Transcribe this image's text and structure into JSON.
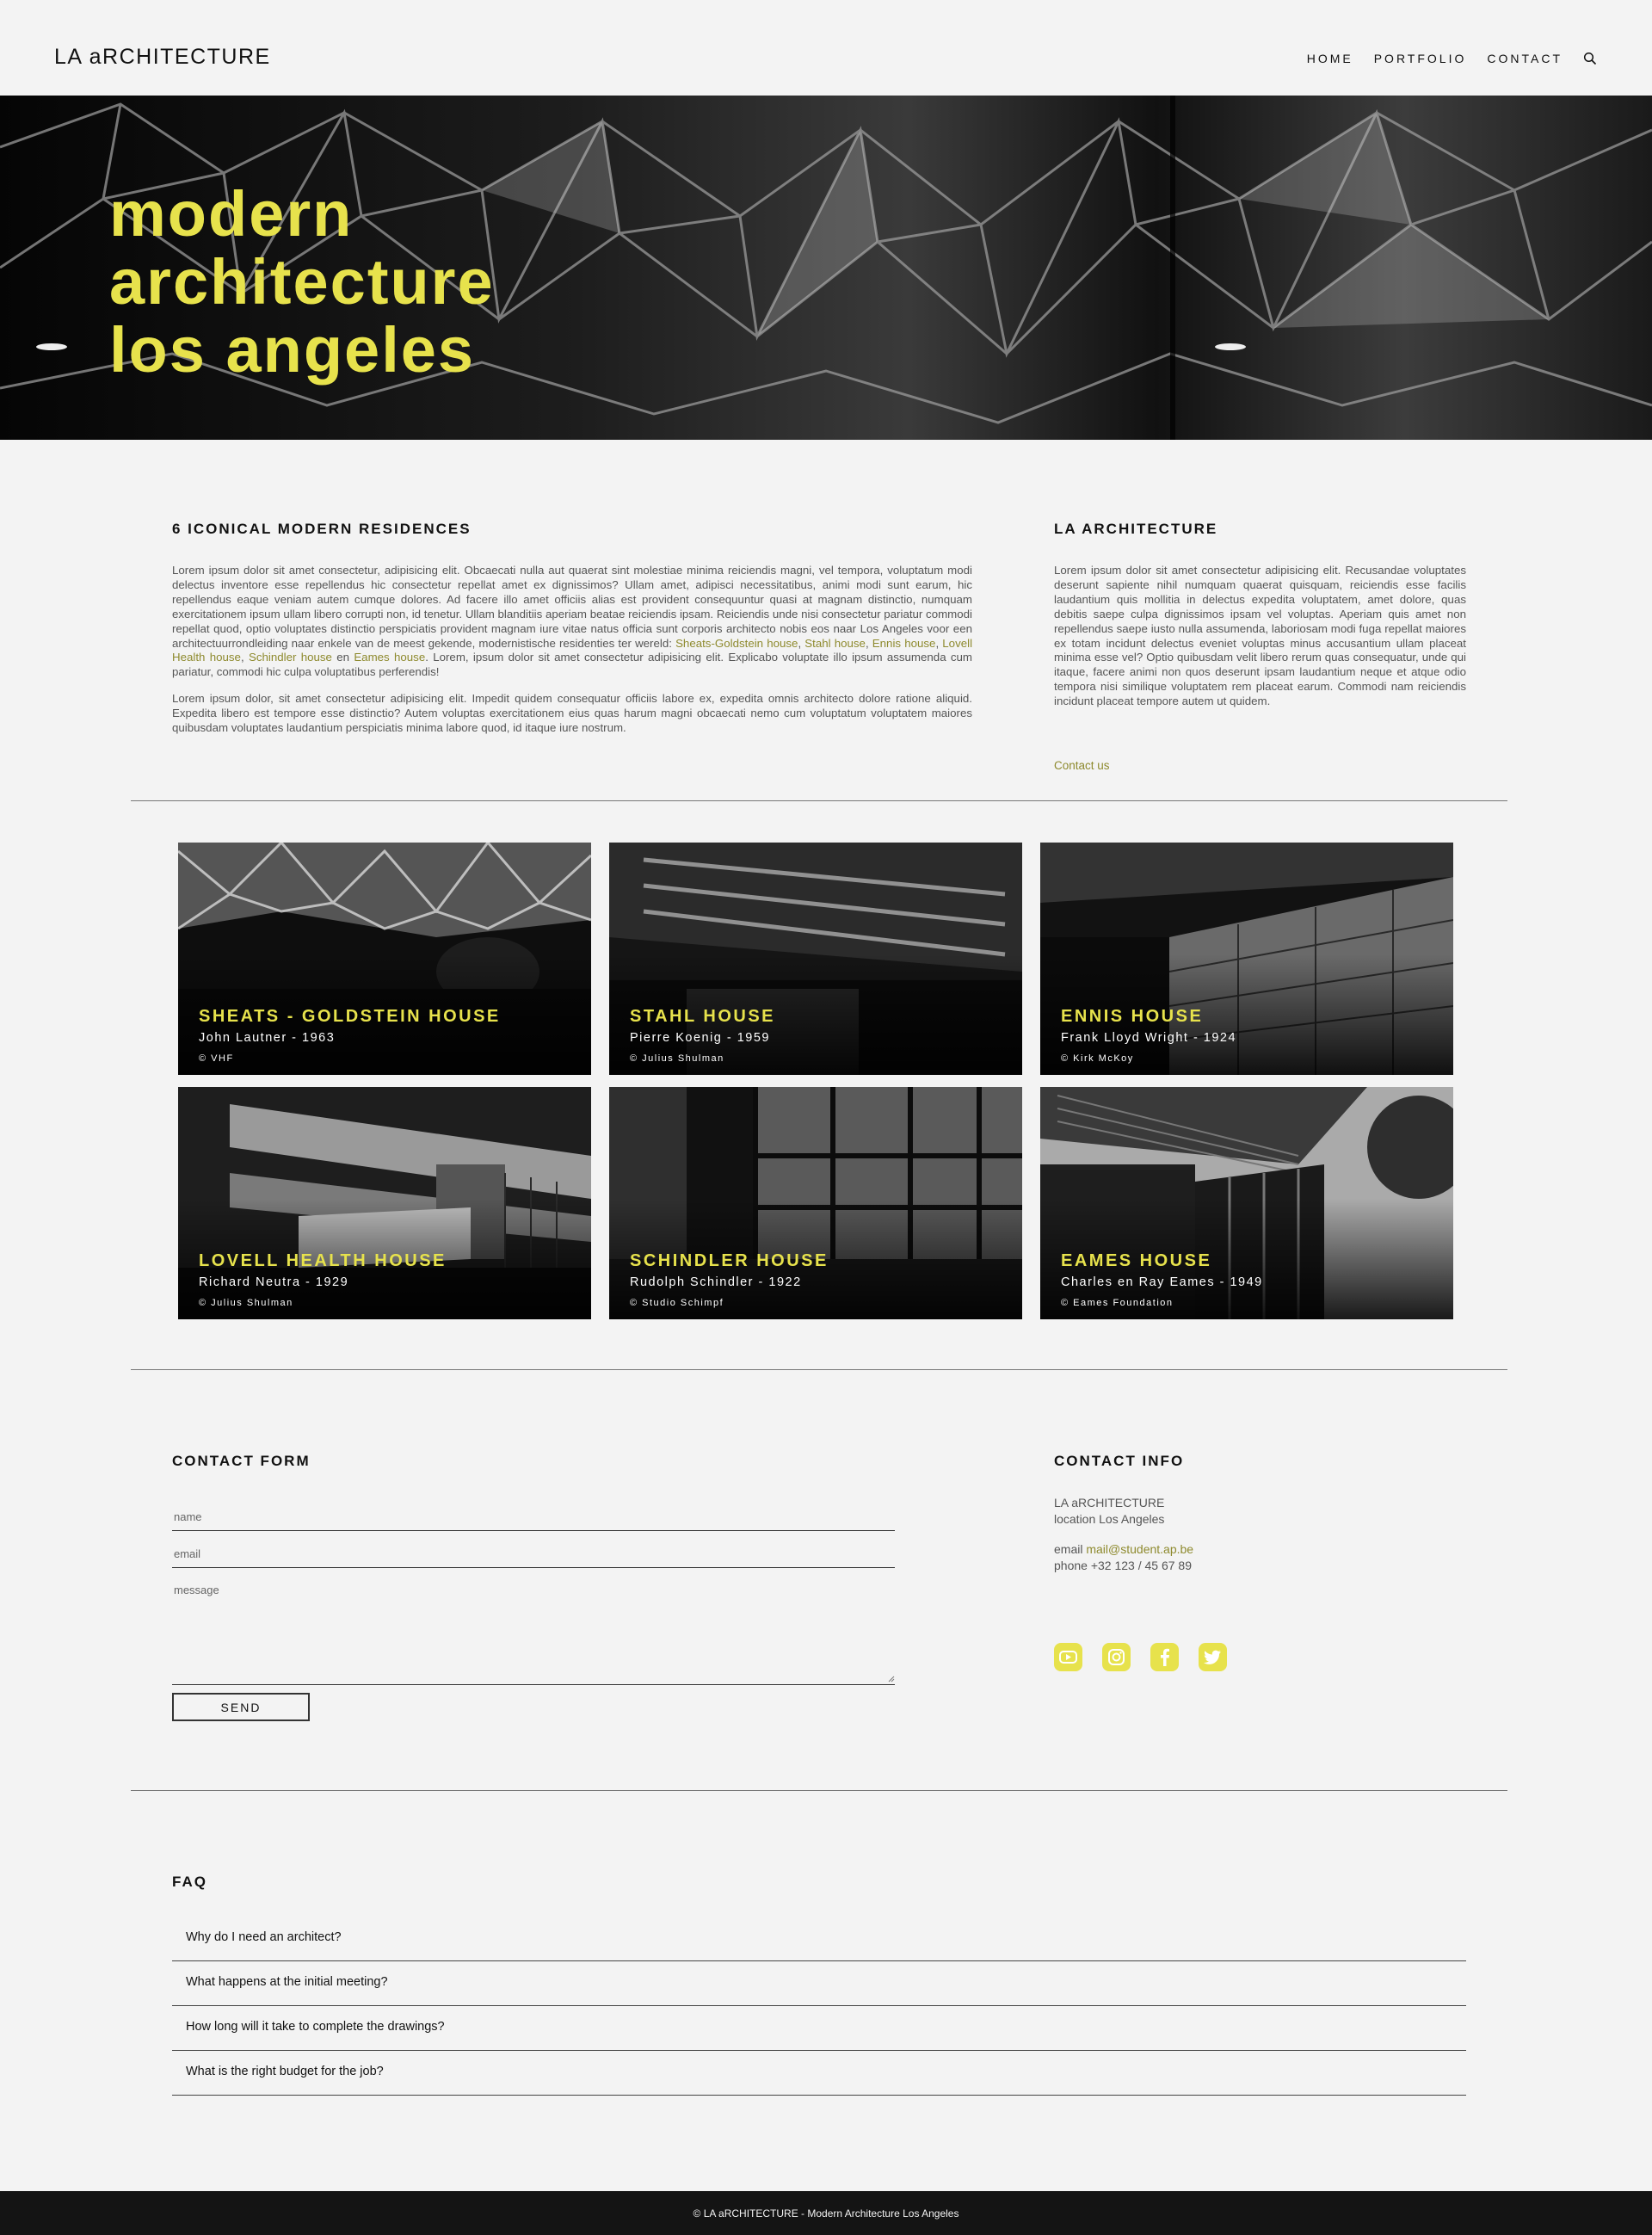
{
  "header": {
    "logo": "LA aRCHITECTURE",
    "nav": [
      "HOME",
      "PORTFOLIO",
      "CONTACT"
    ],
    "search_icon": "search-icon"
  },
  "hero": {
    "title_lines": [
      "modern",
      "architecture",
      "los angeles"
    ],
    "accent_color": "#e7e24c"
  },
  "intro": {
    "heading": "6 ICONICAL MODERN RESIDENCES",
    "para1_a": "Lorem ipsum dolor sit amet consectetur, adipisicing elit. Obcaecati nulla aut quaerat sint molestiae minima reiciendis magni, vel tempora, voluptatum modi delectus inventore esse repellendus hic consectetur repellat amet ex dignissimos? Ullam amet, adipisci necessitatibus, animi modi sunt earum, hic repellendus eaque veniam autem cumque dolores. Ad facere illo amet officiis alias est provident consequuntur quasi at magnam distinctio, numquam exercitationem ipsum ullam libero corrupti non, id tenetur. Ullam blanditiis aperiam beatae reiciendis ipsam. Reiciendis unde nisi consectetur pariatur commodi repellat quod, optio voluptates distinctio perspiciatis provident magnam iure vitae natus officia sunt corporis architecto nobis eos naar Los Angeles voor een architectuurrondleiding naar enkele van de meest gekende, modernistische residenties ter wereld: ",
    "links": [
      "Sheats-Goldstein house",
      "Stahl house",
      "Ennis house",
      "Lovell Health house",
      "Schindler house",
      "Eames house"
    ],
    "sep_comma": ", ",
    "sep_and": " en ",
    "para1_b": ". Lorem, ipsum dolor sit amet consectetur adipisicing elit. Explicabo voluptate illo ipsum assumenda cum pariatur, commodi hic culpa voluptatibus perferendis!",
    "para2": "Lorem ipsum dolor, sit amet consectetur adipisicing elit. Impedit quidem consequatur officiis labore ex, expedita omnis architecto dolore ratione aliquid. Expedita libero est tempore esse distinctio? Autem voluptas exercitationem eius quas harum magni obcaecati nemo cum voluptatum voluptatem maiores quibusdam voluptates laudantium perspiciatis minima labore quod, id itaque iure nostrum."
  },
  "about": {
    "heading": "LA ARCHITECTURE",
    "text": "Lorem ipsum dolor sit amet consectetur adipisicing elit. Recusandae voluptates deserunt sapiente nihil numquam quaerat quisquam, reiciendis esse facilis laudantium quis mollitia in delectus expedita voluptatem, amet dolore, quas debitis saepe culpa dignissimos ipsam vel voluptas. Aperiam quis amet non repellendus saepe iusto nulla assumenda, laboriosam modi fuga repellat maiores ex totam incidunt delectus eveniet voluptas minus accusantium ullam placeat minima esse vel? Optio quibusdam velit libero rerum quas consequatur, unde qui itaque, facere animi non quos deserunt ipsam laudantium neque et atque odio tempora nisi similique voluptatem rem placeat earum. Commodi nam reiciendis incidunt placeat tempore autem ut quidem.",
    "link": "Contact us"
  },
  "portfolio": [
    {
      "title": "SHEATS - GOLDSTEIN HOUSE",
      "architect": "John Lautner - 1963",
      "credit": "© VHF"
    },
    {
      "title": "STAHL HOUSE",
      "architect": "Pierre Koenig - 1959",
      "credit": "© Julius Shulman"
    },
    {
      "title": "ENNIS HOUSE",
      "architect": "Frank Lloyd Wright - 1924",
      "credit": "© Kirk McKoy"
    },
    {
      "title": "LOVELL HEALTH HOUSE",
      "architect": "Richard Neutra - 1929",
      "credit": "© Julius Shulman"
    },
    {
      "title": "SCHINDLER HOUSE",
      "architect": "Rudolph Schindler - 1922",
      "credit": "© Studio Schimpf"
    },
    {
      "title": "EAMES HOUSE",
      "architect": "Charles en Ray Eames - 1949",
      "credit": "© Eames Foundation"
    }
  ],
  "contact_form": {
    "heading": "CONTACT FORM",
    "name_placeholder": "name",
    "email_placeholder": "email",
    "message_placeholder": "message",
    "send_label": "SEND"
  },
  "contact_info": {
    "heading": "CONTACT INFO",
    "company": "LA aRCHITECTURE",
    "location": "location Los Angeles",
    "email_label": "email ",
    "email": "mail@student.ap.be",
    "phone": "phone +32 123 / 45 67 89",
    "social_icons": [
      "youtube-icon",
      "instagram-icon",
      "facebook-icon",
      "twitter-icon"
    ]
  },
  "faq": {
    "heading": "FAQ",
    "questions": [
      "Why do I need an architect?",
      "What happens at the initial meeting?",
      "How long will it take to complete the drawings?",
      "What is the right budget for the job?"
    ]
  },
  "footer": {
    "text": "© LA aRCHITECTURE - Modern Architecture Los Angeles"
  }
}
